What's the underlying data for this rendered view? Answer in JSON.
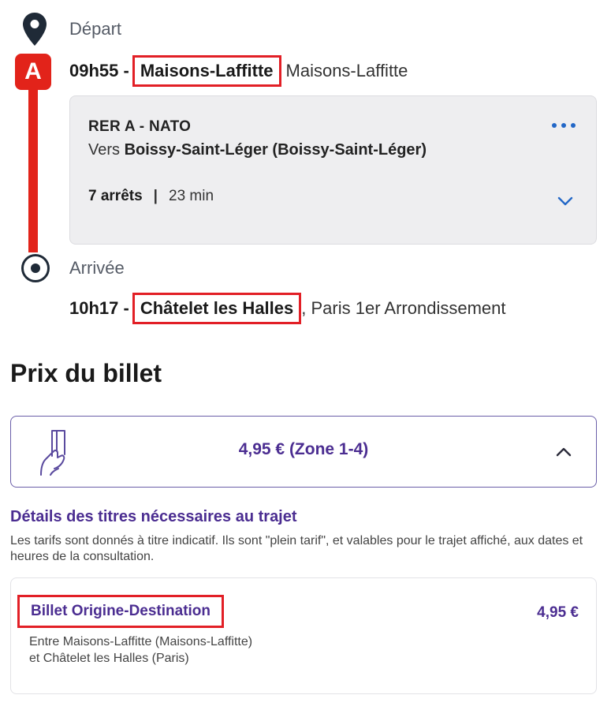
{
  "journey": {
    "departure": {
      "label": "Départ",
      "time_prefix": "09h55 -",
      "stop": "Maisons-Laffitte",
      "city": "Maisons-Laffitte"
    },
    "line_badge": "A",
    "line_color": "#e2231a",
    "train": {
      "title": "RER A - NATO",
      "direction_prefix": "Vers",
      "direction": "Boissy-Saint-Léger (Boissy-Saint-Léger)",
      "stops": "7 arrêts",
      "separator": "|",
      "duration": "23 min"
    },
    "arrival": {
      "label": "Arrivée",
      "time_prefix": "10h17 -",
      "stop": "Châtelet les Halles",
      "city": ", Paris 1er Arrondissement"
    }
  },
  "price": {
    "section_title": "Prix du billet",
    "summary": "4,95 € (Zone 1-4)",
    "accent_color": "#4b2d91",
    "details_title": "Détails des titres nécessaires au trajet",
    "details_desc": "Les tarifs sont donnés à titre indicatif. Ils sont \"plein tarif\", et valables pour le trajet affiché, aux dates et heures de la consultation.",
    "ticket": {
      "name": "Billet Origine-Destination",
      "amount": "4,95 €",
      "desc_line1": "Entre Maisons-Laffitte (Maisons-Laffitte)",
      "desc_line2": "et Châtelet les Halles (Paris)"
    }
  },
  "icons": {
    "departure": "map-pin-icon",
    "arrival": "target-dot-icon",
    "more": "more-dots-icon",
    "expand": "chevron-down-icon",
    "collapse": "chevron-up-icon",
    "ticket": "hand-ticket-icon"
  }
}
